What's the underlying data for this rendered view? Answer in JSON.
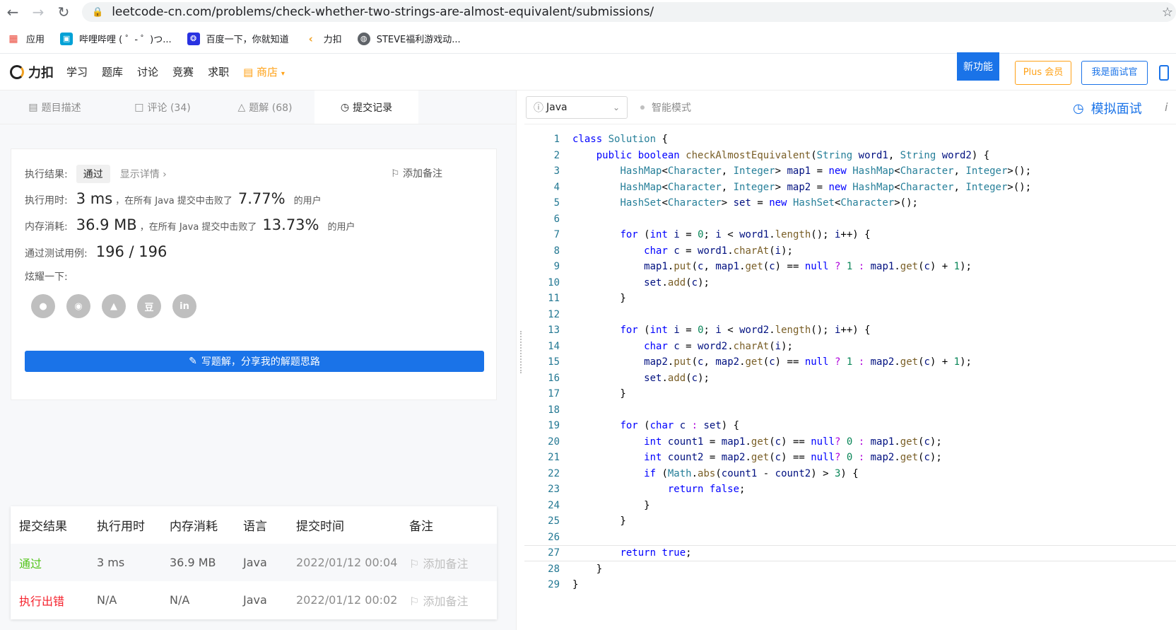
{
  "browser": {
    "url": "leetcode-cn.com/problems/check-whether-two-strings-are-almost-equivalent/submissions/",
    "bookmarks": [
      {
        "label": "应用",
        "icon": "apps-grid-icon"
      },
      {
        "label": "哔哩哔哩 ( ゜- ゜)つ...",
        "icon": "bilibili-icon"
      },
      {
        "label": "百度一下，你就知道",
        "icon": "baidu-paw-icon"
      },
      {
        "label": "力扣",
        "icon": "leetcode-icon"
      },
      {
        "label": "STEVE福利游戏动...",
        "icon": "globe-icon"
      }
    ]
  },
  "header": {
    "logo_text": "力扣",
    "nav": [
      "学习",
      "题库",
      "讨论",
      "竞赛",
      "求职"
    ],
    "shop": "商店",
    "new_feature": "新功能",
    "plus": "Plus 会员",
    "interviewer": "我是面试官"
  },
  "tabs": [
    {
      "label": "题目描述",
      "icon": "doc-icon"
    },
    {
      "label": "评论 (34)",
      "icon": "comment-icon"
    },
    {
      "label": "题解 (68)",
      "icon": "flask-icon"
    },
    {
      "label": "提交记录",
      "icon": "clock-icon"
    }
  ],
  "result": {
    "exec_label": "执行结果:",
    "status": "通过",
    "detail": "显示详情 ›",
    "add_note": "添加备注",
    "time_label": "执行用时:",
    "time_value": "3 ms",
    "time_text": "，在所有 Java 提交中击败了",
    "time_pct": "7.77%",
    "users_suffix": "的用户",
    "mem_label": "内存消耗:",
    "mem_value": "36.9 MB",
    "mem_text": "，在所有 Java 提交中击败了",
    "mem_pct": "13.73%",
    "tests_label": "通过测试用例:",
    "tests_value": "196 / 196",
    "share_label": "炫耀一下:",
    "share_icons": [
      "wechat-icon",
      "weibo-icon",
      "qq-icon",
      "douban-icon",
      "linkedin-icon"
    ],
    "write_btn": "写题解，分享我的解题思路"
  },
  "submissions": {
    "headers": [
      "提交结果",
      "执行用时",
      "内存消耗",
      "语言",
      "提交时间",
      "备注"
    ],
    "rows": [
      {
        "status": "通过",
        "time": "3 ms",
        "memory": "36.9 MB",
        "lang": "Java",
        "submitted": "2022/01/12 00:04",
        "note": "添加备注"
      },
      {
        "status": "执行出错",
        "time": "N/A",
        "memory": "N/A",
        "lang": "Java",
        "submitted": "2022/01/12 00:02",
        "note": "添加备注"
      }
    ]
  },
  "editor": {
    "language": "Java",
    "smart_mode": "智能模式",
    "mock_interview": "模拟面试",
    "info": "i",
    "code_lines": [
      "class Solution {",
      "    public boolean checkAlmostEquivalent(String word1, String word2) {",
      "        HashMap<Character, Integer> map1 = new HashMap<Character, Integer>();",
      "        HashMap<Character, Integer> map2 = new HashMap<Character, Integer>();",
      "        HashSet<Character> set = new HashSet<Character>();",
      "",
      "        for (int i = 0; i < word1.length(); i++) {",
      "            char c = word1.charAt(i);",
      "            map1.put(c, map1.get(c) == null ? 1 : map1.get(c) + 1);",
      "            set.add(c);",
      "        }",
      "",
      "        for (int i = 0; i < word2.length(); i++) {",
      "            char c = word2.charAt(i);",
      "            map2.put(c, map2.get(c) == null ? 1 : map2.get(c) + 1);",
      "            set.add(c);",
      "        }",
      "",
      "        for (char c : set) {",
      "            int count1 = map1.get(c) == null? 0 : map1.get(c);",
      "            int count2 = map2.get(c) == null? 0 : map2.get(c);",
      "            if (Math.abs(count1 - count2) > 3) {",
      "                return false;",
      "            }",
      "        }",
      "",
      "        return true;",
      "    }",
      "}"
    ],
    "active_line": 27
  },
  "colors": {
    "accent": "#1a73e8",
    "pass": "#52c41a",
    "error": "#f5222d",
    "shop": "#ffa116"
  }
}
